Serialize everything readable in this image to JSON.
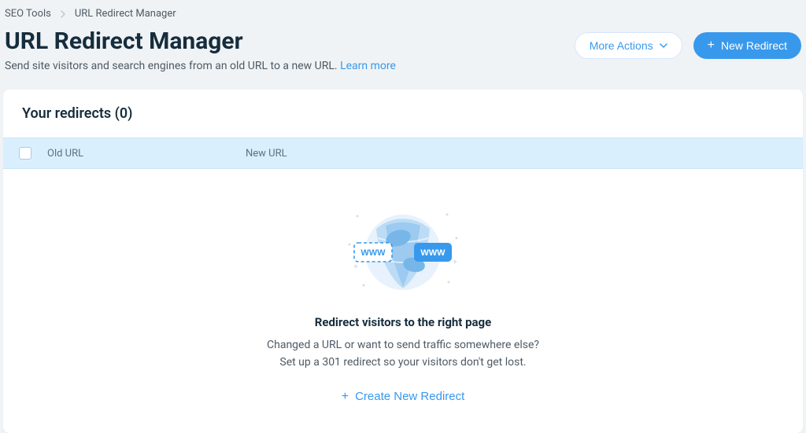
{
  "breadcrumb": {
    "parent": "SEO Tools",
    "current": "URL Redirect Manager"
  },
  "header": {
    "title": "URL Redirect Manager",
    "subtitle_text": "Send site visitors and search engines from an old URL to a new URL. ",
    "learn_more": "Learn more"
  },
  "actions": {
    "more_actions": "More Actions",
    "new_redirect": "New Redirect"
  },
  "card": {
    "title": "Your redirects (0)",
    "columns": {
      "old_url": "Old URL",
      "new_url": "New URL"
    },
    "empty": {
      "title": "Redirect visitors to the right page",
      "line1": "Changed a URL or want to send traffic somewhere else?",
      "line2": "Set up a 301 redirect so your visitors don't get lost.",
      "cta": "Create New Redirect",
      "badge_old": "WWW",
      "badge_new": "WWW"
    }
  },
  "colors": {
    "primary": "#3899ec",
    "header_bg": "#daeffe"
  }
}
